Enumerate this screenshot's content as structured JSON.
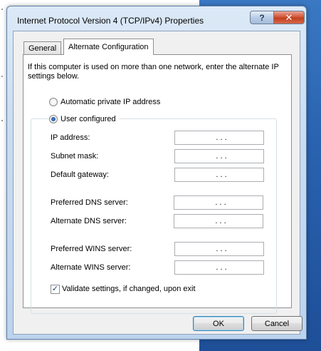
{
  "window": {
    "title": "Internet Protocol Version 4 (TCP/IPv4) Properties",
    "help_label": "?",
    "close_label": "✕"
  },
  "tabs": [
    {
      "label": "General",
      "active": false
    },
    {
      "label": "Alternate Configuration",
      "active": true
    }
  ],
  "intro_text": "If this computer is used on more than one network, enter the alternate IP settings below.",
  "radios": {
    "automatic": {
      "label": "Automatic private IP address",
      "checked": false
    },
    "user": {
      "label": "User configured",
      "checked": true
    }
  },
  "fields": {
    "ip_address": {
      "label": "IP address:",
      "value": ". . ."
    },
    "subnet_mask": {
      "label": "Subnet mask:",
      "value": ". . ."
    },
    "default_gateway": {
      "label": "Default gateway:",
      "value": ". . ."
    },
    "preferred_dns": {
      "label": "Preferred DNS server:",
      "value": ". . ."
    },
    "alternate_dns": {
      "label": "Alternate DNS server:",
      "value": ". . ."
    },
    "preferred_wins": {
      "label": "Preferred WINS server:",
      "value": ". . ."
    },
    "alternate_wins": {
      "label": "Alternate WINS server:",
      "value": ". . ."
    }
  },
  "validate": {
    "label": "Validate settings, if changed, upon exit",
    "checked": true,
    "mark": "✓"
  },
  "buttons": {
    "ok": "OK",
    "cancel": "Cancel"
  }
}
